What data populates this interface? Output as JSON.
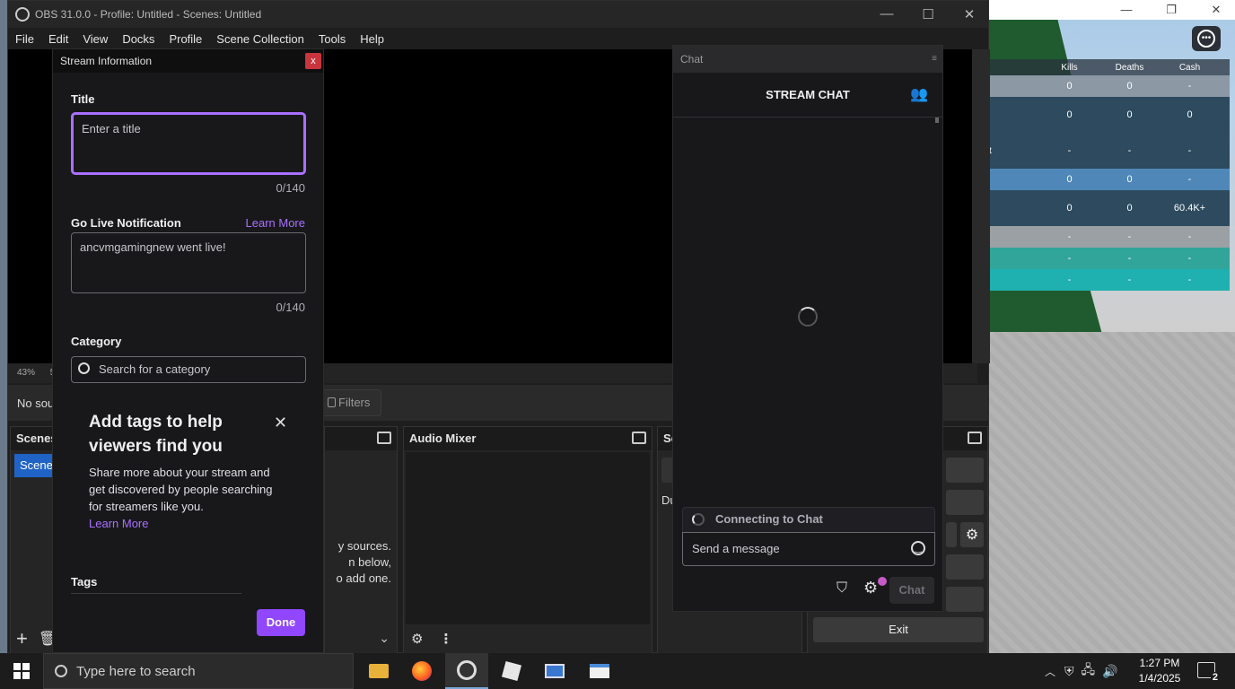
{
  "obs": {
    "window_title": "OBS 31.0.0 - Profile: Untitled - Scenes: Untitled",
    "menu": [
      "File",
      "Edit",
      "View",
      "Docks",
      "Profile",
      "Scene Collection",
      "Tools",
      "Help"
    ],
    "zoom_text": "43%",
    "zoom_suffix": "5",
    "no_source_text": "No sou",
    "filters_label": "Filters",
    "docks": {
      "scenes": {
        "title": "Scenes",
        "item": "Scene"
      },
      "sources": {
        "hint_lines": [
          "y sources.",
          "n below,",
          "o add one."
        ]
      },
      "audio_mixer": {
        "title": "Audio Mixer"
      },
      "scene_transitions": {
        "title": "Sc",
        "row_text": "Du"
      },
      "controls": {
        "exit_label": "Exit"
      }
    }
  },
  "stream_info": {
    "dialog_title": "Stream Information",
    "close_label": "x",
    "title_label": "Title",
    "title_placeholder": "Enter a title",
    "title_count": "0/140",
    "notification_label": "Go Live Notification",
    "learn_more": "Learn More",
    "notification_value": "ancvmgamingnew went live!",
    "notification_count": "0/140",
    "category_label": "Category",
    "category_placeholder": "Search for a category",
    "tags_card": {
      "heading": "Add tags to help viewers find you",
      "body": "Share more about your stream and get discovered by people searching for streamers like you.",
      "learn_more": "Learn More"
    },
    "tags_label": "Tags",
    "done_label": "Done"
  },
  "chat": {
    "dock_title": "Chat",
    "header": "STREAM CHAT",
    "connecting": "Connecting to Chat",
    "message_placeholder": "Send a message",
    "send_label": "Chat"
  },
  "game": {
    "leaderboard": {
      "columns": [
        "Kills",
        "Deaths",
        "Cash"
      ],
      "rows": [
        {
          "name": "",
          "kills": "0",
          "deaths": "0",
          "cash": "-",
          "color": "#8c98a4"
        },
        {
          "name": "",
          "kills": "0",
          "deaths": "0",
          "cash": "0",
          "color": "#2d4a5e"
        },
        {
          "name": "t",
          "kills": "-",
          "deaths": "-",
          "cash": "-",
          "color": "#2d4a5e"
        },
        {
          "name": "",
          "kills": "0",
          "deaths": "0",
          "cash": "-",
          "color": "#4f88b8"
        },
        {
          "name": "",
          "kills": "0",
          "deaths": "0",
          "cash": "60.4K+",
          "color": "#2d4a5e"
        },
        {
          "name": "",
          "kills": "-",
          "deaths": "-",
          "cash": "-",
          "color": "#9aa0a4"
        },
        {
          "name": "",
          "kills": "-",
          "deaths": "-",
          "cash": "-",
          "color": "#32a59a"
        },
        {
          "name": "",
          "kills": "-",
          "deaths": "-",
          "cash": "-",
          "color": "#1fb0b0"
        }
      ]
    }
  },
  "taskbar": {
    "search_placeholder": "Type here to search",
    "time": "1:27 PM",
    "date": "1/4/2025",
    "notification_count": "2"
  }
}
